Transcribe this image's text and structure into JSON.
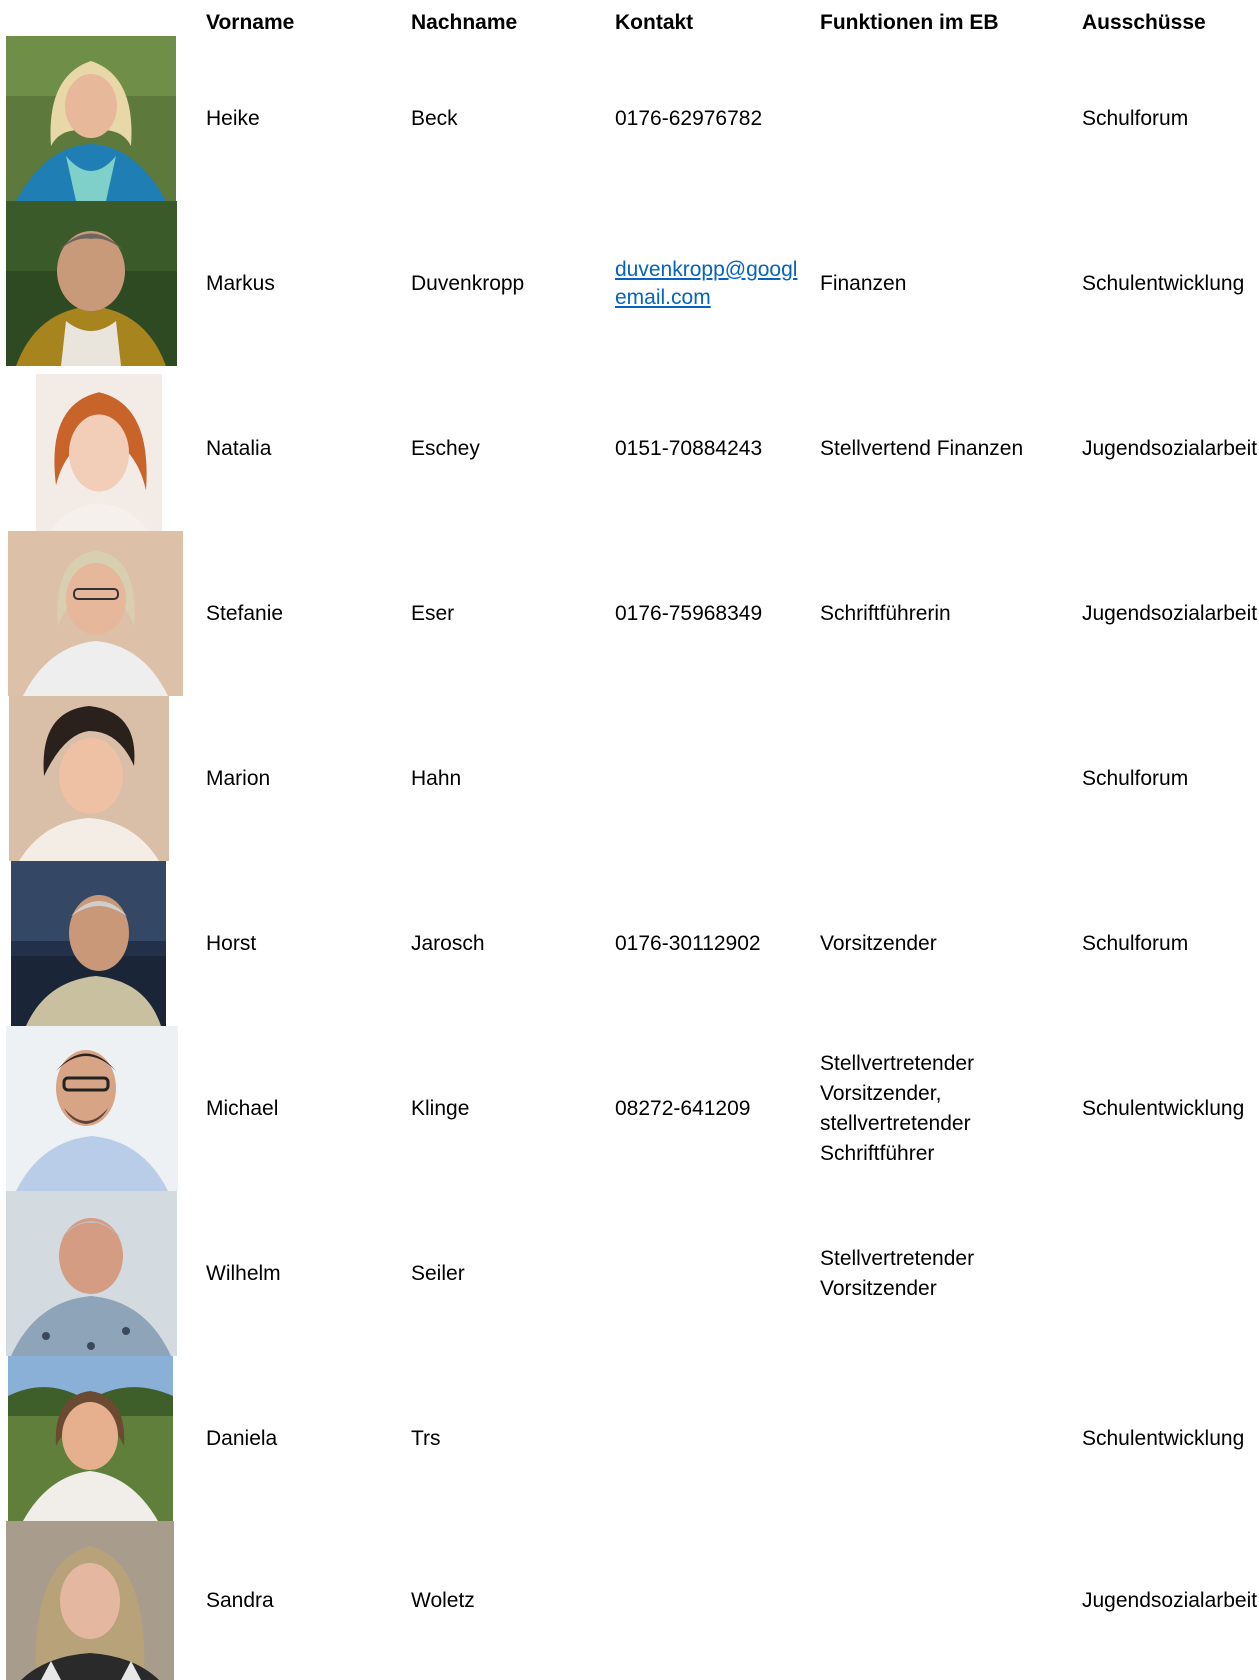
{
  "header": {
    "vorname": "Vorname",
    "nachname": "Nachname",
    "kontakt": "Kontakt",
    "funktionen": "Funktionen im EB",
    "ausschuesse": "Ausschüsse"
  },
  "rows": [
    {
      "vorname": "Heike",
      "nachname": "Beck",
      "kontakt": "0176-62976782",
      "funktion": "",
      "ausschuss": "Schulforum"
    },
    {
      "vorname": "Markus",
      "nachname": "Duvenkropp",
      "kontakt": "duvenkropp@googlemail.com",
      "funktion": "Finanzen",
      "ausschuss": "Schulentwicklung"
    },
    {
      "vorname": "Natalia",
      "nachname": "Eschey",
      "kontakt": "0151-70884243",
      "funktion": "Stellvertend Finanzen",
      "ausschuss": "Jugendsozialarbeit"
    },
    {
      "vorname": "Stefanie",
      "nachname": "Eser",
      "kontakt": "0176-75968349",
      "funktion": "Schriftführerin",
      "ausschuss": "Jugendsozialarbeit"
    },
    {
      "vorname": "Marion",
      "nachname": "Hahn",
      "kontakt": "",
      "funktion": "",
      "ausschuss": "Schulforum"
    },
    {
      "vorname": "Horst",
      "nachname": "Jarosch",
      "kontakt": "0176-30112902",
      "funktion": "Vorsitzender",
      "ausschuss": "Schulforum"
    },
    {
      "vorname": "Michael",
      "nachname": "Klinge",
      "kontakt": "08272-641209",
      "funktion": "Stellvertretender Vorsitzender, stellvertretender Schriftführer",
      "ausschuss": "Schulentwicklung"
    },
    {
      "vorname": "Wilhelm",
      "nachname": "Seiler",
      "kontakt": "",
      "funktion": "Stellvertretender Vorsitzender",
      "ausschuss": ""
    },
    {
      "vorname": "Daniela",
      "nachname": "Trs",
      "kontakt": "",
      "funktion": "",
      "ausschuss": "Schulentwicklung"
    },
    {
      "vorname": "Sandra",
      "nachname": "Woletz",
      "kontakt": "",
      "funktion": "",
      "ausschuss": "Jugendsozialarbeit"
    }
  ]
}
